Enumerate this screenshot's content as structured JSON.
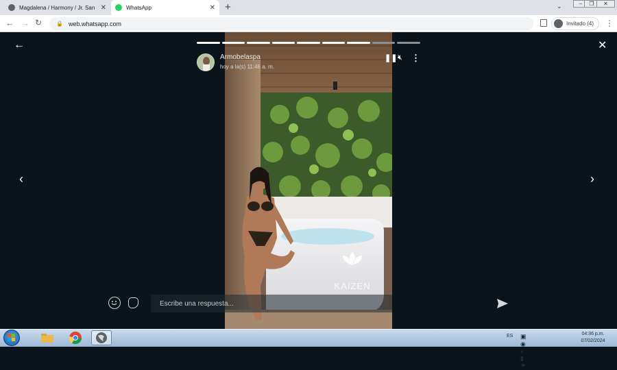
{
  "browser": {
    "tabs": [
      {
        "label": "Magdalena / Harmony / Jr. San M",
        "active": false
      },
      {
        "label": "WhatsApp",
        "active": true
      }
    ],
    "address": "web.whatsapp.com",
    "profile_label": "Invitado (4)"
  },
  "status": {
    "user_name": "Armobelaspa",
    "time_label": "hoy a la(s) 11:46 a. m.",
    "progress_segments_total": 9,
    "progress_segments_viewed": 7,
    "media_watermark": "KAIZEN",
    "reply_placeholder": "Escribe una respuesta..."
  },
  "taskbar": {
    "language": "ES",
    "time": "04:36 p.m.",
    "date": "07/02/2024"
  },
  "colors": {
    "viewer_bg": "#0b141a",
    "whatsapp_green": "#25d366"
  },
  "icons": [
    "back-arrow-icon",
    "close-icon",
    "pause-icon",
    "mute-icon",
    "menu-dots-icon",
    "chevron-left-icon",
    "chevron-right-icon",
    "emoji-icon",
    "sticker-icon",
    "send-icon"
  ]
}
